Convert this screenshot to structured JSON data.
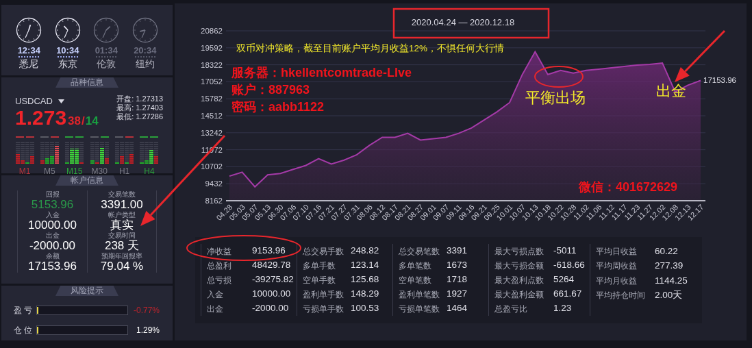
{
  "clocks": [
    {
      "time": "12:34",
      "city": "悉尼",
      "active": true
    },
    {
      "time": "10:34",
      "city": "东京",
      "active": true
    },
    {
      "time": "01:34",
      "city": "伦敦",
      "active": false
    },
    {
      "time": "20:34",
      "city": "纽约",
      "active": false
    }
  ],
  "symbol_panel": {
    "header": "品种信息",
    "symbol": "USDCAD",
    "price_main": "1.273",
    "price_pips": "38",
    "separator": "/",
    "spread": "14",
    "quotes": [
      {
        "label": "开盘:",
        "value": "1.27313"
      },
      {
        "label": "最高:",
        "value": "1.27403"
      },
      {
        "label": "最低:",
        "value": "1.27286"
      }
    ],
    "timeframes": [
      {
        "label": "M1",
        "color": "#b8323a",
        "signals": [
          {
            "color": "#b8323a"
          },
          {
            "color": "#b8323a"
          }
        ],
        "bars": [
          {
            "level": 0.45,
            "color": "#c81e24"
          },
          {
            "level": 0.2,
            "color": "#c81e24"
          },
          {
            "level": 0.06,
            "color": "#22b02a"
          },
          {
            "level": 0.35,
            "color": "#c81e24"
          }
        ]
      },
      {
        "label": "M5",
        "color": "#7a7b85",
        "signals": [
          {
            "color": "#5a5b65"
          },
          {
            "color": "#b8323a"
          }
        ],
        "bars": [
          {
            "level": 0.2,
            "color": "#c81e24"
          },
          {
            "level": 0.25,
            "color": "#22b02a"
          },
          {
            "level": 0.35,
            "color": "#22b02a"
          },
          {
            "level": 0.85,
            "color": "#e04850"
          }
        ]
      },
      {
        "label": "M15",
        "color": "#2aa03a",
        "signals": [
          {
            "color": "#2aa03a"
          },
          {
            "color": "#2aa03a"
          }
        ],
        "bars": [
          {
            "level": 0.1,
            "color": "#22b02a"
          },
          {
            "level": 0.7,
            "color": "#3ed83a"
          },
          {
            "level": 0.7,
            "color": "#3ed83a"
          },
          {
            "level": 0.1,
            "color": "#c81e24"
          }
        ]
      },
      {
        "label": "M30",
        "color": "#7a7b85",
        "signals": [
          {
            "color": "#5a5b65"
          },
          {
            "color": "#2aa03a"
          }
        ],
        "bars": [
          {
            "level": 0.15,
            "color": "#22b02a"
          },
          {
            "level": 0.1,
            "color": "#c81e24"
          },
          {
            "level": 0.75,
            "color": "#3ed83a"
          },
          {
            "level": 0.25,
            "color": "#c81e24"
          }
        ]
      },
      {
        "label": "H1",
        "color": "#7a7b85",
        "signals": [
          {
            "color": "#5a5b65"
          },
          {
            "color": "#b8323a"
          }
        ],
        "bars": [
          {
            "level": 0.06,
            "color": "#22b02a"
          },
          {
            "level": 0.35,
            "color": "#c81e24"
          },
          {
            "level": 0.06,
            "color": "#22b02a"
          },
          {
            "level": 0.45,
            "color": "#c81e24"
          }
        ]
      },
      {
        "label": "H4",
        "color": "#2aa03a",
        "signals": [
          {
            "color": "#2aa03a"
          },
          {
            "color": "#2aa03a"
          }
        ],
        "bars": [
          {
            "level": 0.06,
            "color": "#22b02a"
          },
          {
            "level": 0.15,
            "color": "#22b02a"
          },
          {
            "level": 0.65,
            "color": "#3ed83a"
          },
          {
            "level": 0.35,
            "color": "#c81e24"
          }
        ]
      }
    ]
  },
  "account_panel": {
    "header": "帐户信息",
    "columns": [
      [
        {
          "label": "回报",
          "value": "5153.96",
          "color": "#2a9a4a"
        },
        {
          "label": "入金",
          "value": "10000.00",
          "color": "#ffffff"
        },
        {
          "label": "出金",
          "value": "-2000.00",
          "color": "#ffffff"
        },
        {
          "label": "余额",
          "value": "17153.96",
          "color": "#ffffff"
        }
      ],
      [
        {
          "label": "交易笔数",
          "value": "3391.00",
          "color": "#ffffff"
        },
        {
          "label": "帐户类型",
          "value": "真实",
          "color": "#ffffff"
        },
        {
          "label": "交易时间",
          "value": "238 天",
          "color": "#ffffff"
        },
        {
          "label": "预期年回报率",
          "value": "79.04 %",
          "color": "#ffffff"
        }
      ]
    ]
  },
  "risk_panel": {
    "header": "风险提示",
    "rows": [
      {
        "label": "盈 亏",
        "level": 0.01,
        "value": "-0.77%",
        "color": "#c0242c"
      },
      {
        "label": "仓 位",
        "level": 0.01,
        "value": "1.29%",
        "color": "#ffffff"
      }
    ]
  },
  "chart": {
    "last_value": "17153.96",
    "chart_data": {
      "type": "area",
      "title": "2020.04.24 — 2020.12.18",
      "categories": [
        "04.28",
        "05.03",
        "05.07",
        "05.13",
        "06.30",
        "07.06",
        "07.10",
        "07.16",
        "07.21",
        "07.27",
        "07.31",
        "08.06",
        "08.12",
        "08.17",
        "08.21",
        "08.27",
        "09.01",
        "09.07",
        "09.11",
        "09.16",
        "09.21",
        "09.25",
        "10.01",
        "10.07",
        "10.13",
        "10.18",
        "10.22",
        "10.28",
        "11.02",
        "11.06",
        "11.12",
        "11.17",
        "11.23",
        "11.27",
        "12.02",
        "12.08",
        "12.13",
        "12.17"
      ],
      "series": [
        {
          "color": "#a53aa8",
          "values": [
            10000,
            10300,
            9200,
            10100,
            10200,
            10500,
            10800,
            11300,
            10900,
            11200,
            11600,
            12300,
            12900,
            12900,
            13200,
            12700,
            12800,
            12900,
            13200,
            13600,
            14200,
            14800,
            15500,
            17600,
            19300,
            17600,
            17900,
            17700,
            17900,
            18000,
            18100,
            18200,
            18300,
            18350,
            18450,
            16300,
            16800,
            17150
          ]
        }
      ],
      "grid": true,
      "ylim": [
        8162,
        20862
      ],
      "yticks": [
        8162,
        9432,
        10702,
        11972,
        13242,
        14512,
        15782,
        17052,
        18322,
        19592,
        20862
      ]
    }
  },
  "notes": [
    {
      "kind": "yellow",
      "text": "双币对冲策略，截至目前账户平均月收益12%，不惧任何大行情"
    },
    {
      "kind": "red",
      "text": "服务器：hkellentcomtrade-LIve"
    },
    {
      "kind": "red",
      "text": "账户：887963"
    },
    {
      "kind": "red",
      "text": "密码：aabb1122"
    },
    {
      "kind": "label",
      "text": "平衡出场"
    },
    {
      "kind": "label",
      "text": "出金"
    },
    {
      "kind": "red",
      "text": "微信：401672629"
    }
  ],
  "stats": [
    [
      {
        "label": "净收益",
        "value": "9153.96"
      },
      {
        "label": "总盈利",
        "value": "48429.78"
      },
      {
        "label": "总亏损",
        "value": "-39275.82"
      },
      {
        "label": "入金",
        "value": "10000.00"
      },
      {
        "label": "出金",
        "value": "-2000.00"
      }
    ],
    [
      {
        "label": "总交易手数",
        "value": "248.82"
      },
      {
        "label": "多单手数",
        "value": "123.14"
      },
      {
        "label": "空单手数",
        "value": "125.68"
      },
      {
        "label": "盈利单手数",
        "value": "148.29"
      },
      {
        "label": "亏损单手数",
        "value": "100.53"
      }
    ],
    [
      {
        "label": "总交易笔数",
        "value": "3391"
      },
      {
        "label": "多单笔数",
        "value": "1673"
      },
      {
        "label": "空单笔数",
        "value": "1718"
      },
      {
        "label": "盈利单笔数",
        "value": "1927"
      },
      {
        "label": "亏损单笔数",
        "value": "1464"
      }
    ],
    [
      {
        "label": "最大亏损点数",
        "value": "-5011"
      },
      {
        "label": "最大亏损金额",
        "value": "-618.66"
      },
      {
        "label": "最大盈利点数",
        "value": "5264"
      },
      {
        "label": "最大盈利金额",
        "value": "661.67"
      },
      {
        "label": "总盈亏比",
        "value": "1.23"
      }
    ],
    [
      {
        "label": "平均日收益",
        "value": "60.22"
      },
      {
        "label": "平均周收益",
        "value": "277.39"
      },
      {
        "label": "平均月收益",
        "value": "1144.25"
      },
      {
        "label": "平均持仓时间",
        "value": "2.00天"
      }
    ]
  ]
}
